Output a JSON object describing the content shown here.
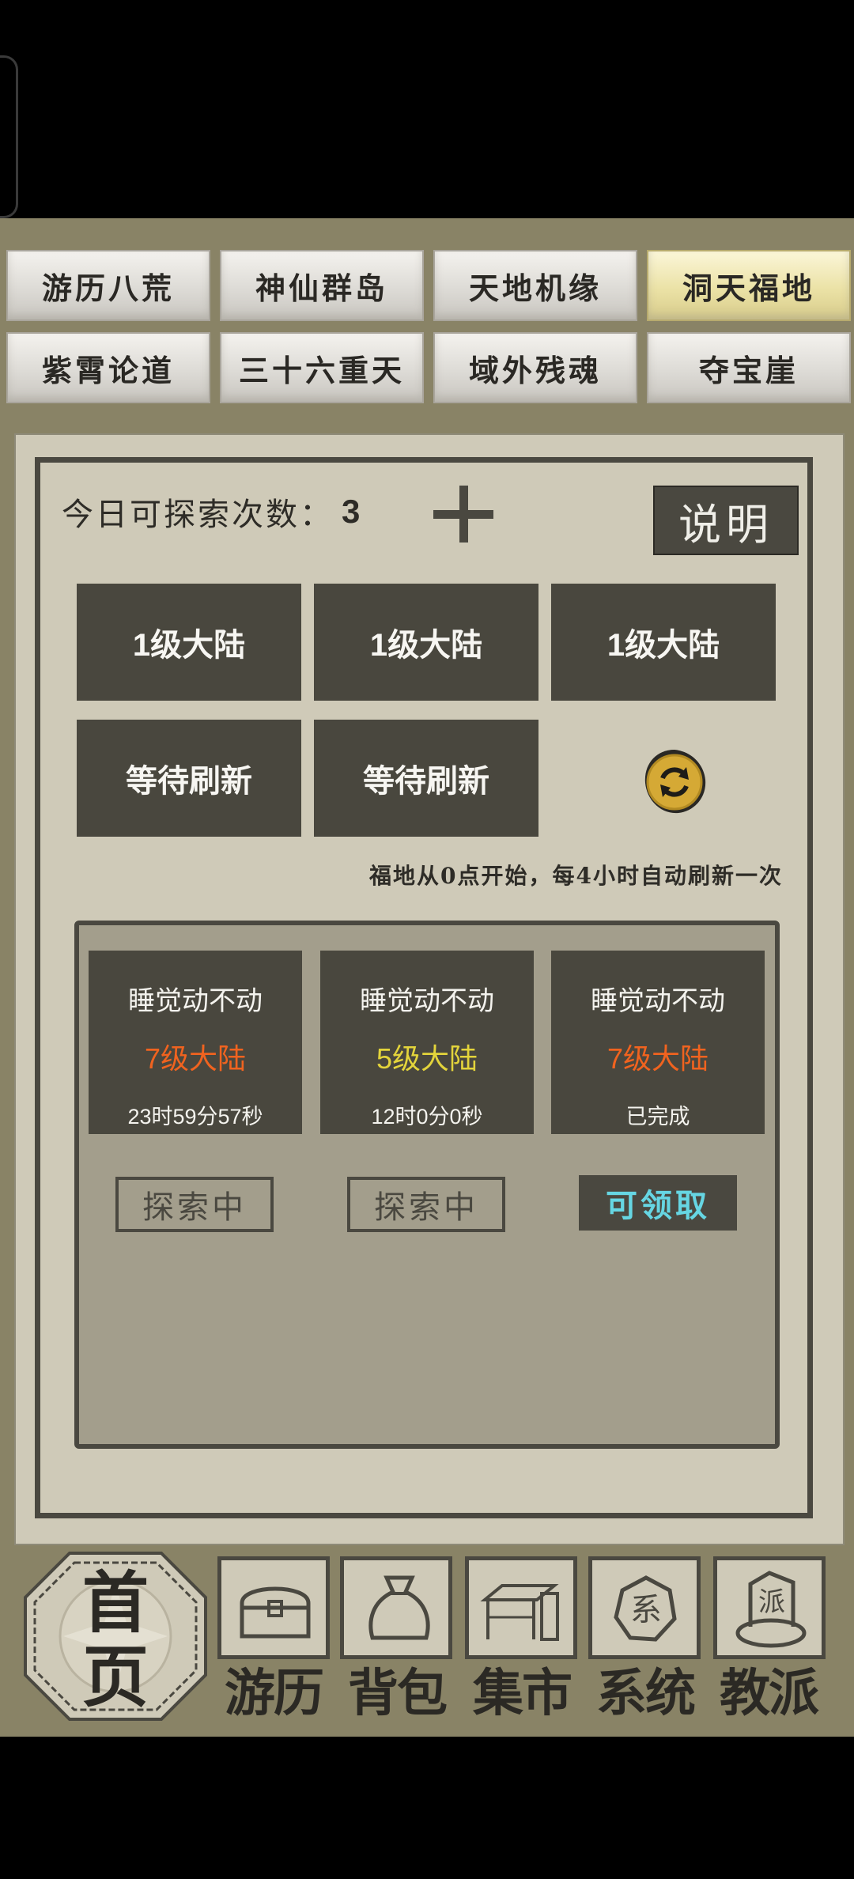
{
  "tabs": {
    "row1": [
      "游历八荒",
      "神仙群岛",
      "天地机缘",
      "洞天福地"
    ],
    "row2": [
      "紫霄论道",
      "三十六重天",
      "域外残魂",
      "夺宝崖"
    ],
    "active": "洞天福地"
  },
  "explore": {
    "count_label": "今日可探索次数：",
    "count_value": "3",
    "help_label": "说明"
  },
  "slots": [
    "1级大陆",
    "1级大陆",
    "1级大陆",
    "等待刷新",
    "等待刷新"
  ],
  "refresh_note": "福地从0点开始，每4小时自动刷新一次",
  "expeditions": [
    {
      "name": "睡觉动不动",
      "level": "7级大陆",
      "level_color": "#f0631f",
      "time": "23时59分57秒",
      "status": "探索中"
    },
    {
      "name": "睡觉动不动",
      "level": "5级大陆",
      "level_color": "#e3d43b",
      "time": "12时0分0秒",
      "status": "探索中"
    },
    {
      "name": "睡觉动不动",
      "level": "7级大陆",
      "level_color": "#f0631f",
      "time": "已完成",
      "status": "可领取"
    }
  ],
  "nav": {
    "home": [
      "首",
      "页"
    ],
    "items": [
      "游历",
      "背包",
      "集市",
      "系统",
      "教派"
    ],
    "icons": [
      "chest-icon",
      "bag-icon",
      "market-stall-icon",
      "system-seal-icon",
      "sect-seal-icon"
    ],
    "seal_texts": [
      "系",
      "派"
    ]
  },
  "colors": {
    "panel": "#cfcab8",
    "dark_button": "#49473e",
    "claim_text": "#66d6e3",
    "active_tab": "#ebe2a6"
  }
}
